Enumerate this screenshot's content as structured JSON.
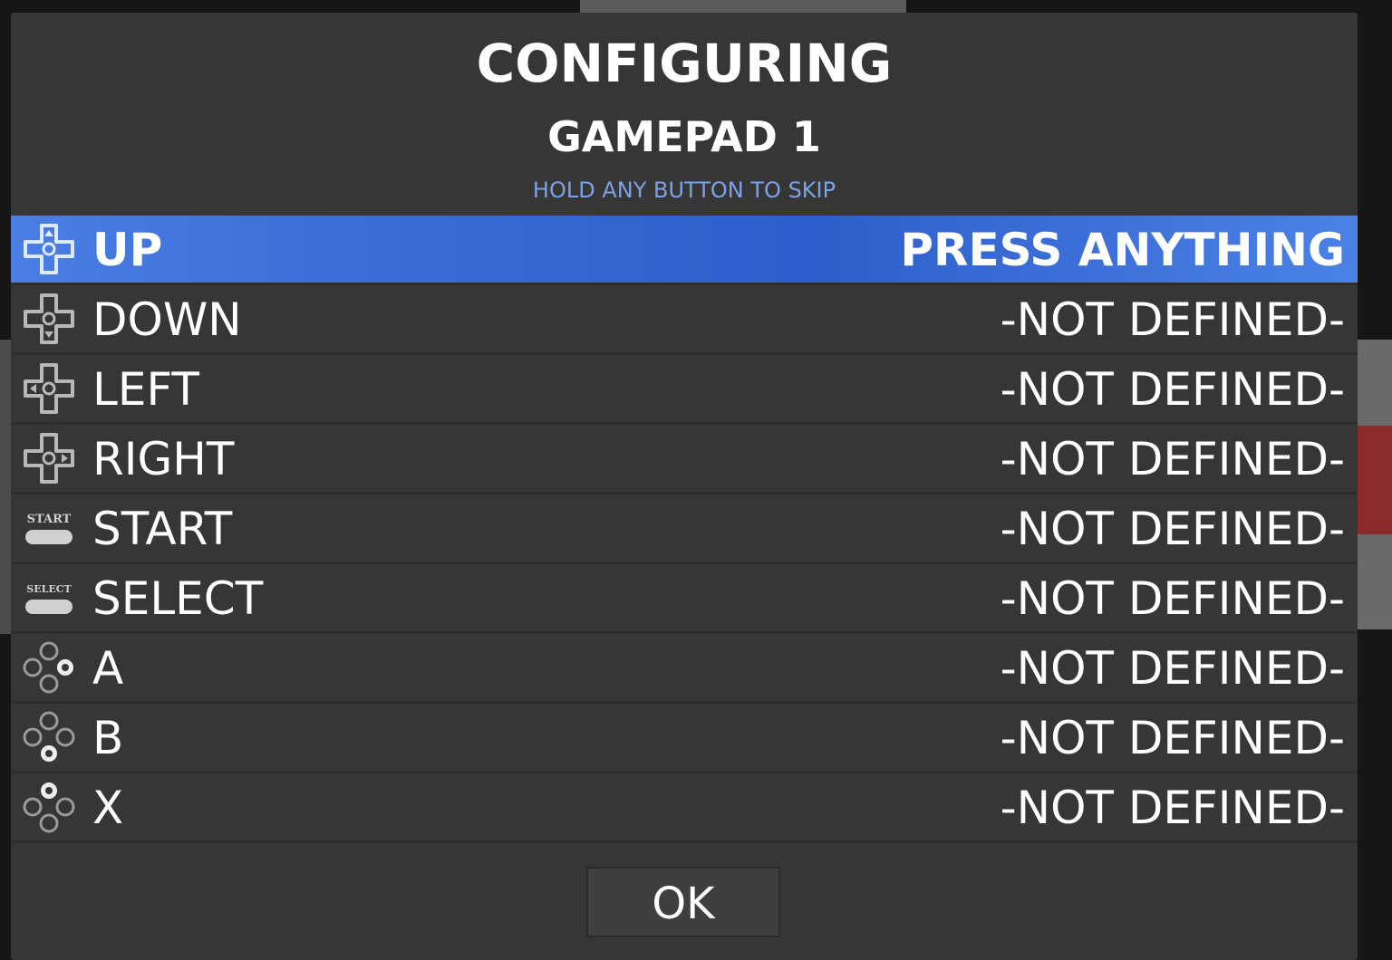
{
  "header": {
    "title": "CONFIGURING",
    "subtitle": "GAMEPAD 1",
    "hint": "HOLD ANY BUTTON TO SKIP"
  },
  "mappings": [
    {
      "label": "UP",
      "value": "PRESS ANYTHING",
      "icon": "dpad-up-icon",
      "selected": true
    },
    {
      "label": "DOWN",
      "value": "-NOT DEFINED-",
      "icon": "dpad-down-icon"
    },
    {
      "label": "LEFT",
      "value": "-NOT DEFINED-",
      "icon": "dpad-left-icon"
    },
    {
      "label": "RIGHT",
      "value": "-NOT DEFINED-",
      "icon": "dpad-right-icon"
    },
    {
      "label": "START",
      "value": "-NOT DEFINED-",
      "icon": "start-button-icon",
      "icon_text": "START"
    },
    {
      "label": "SELECT",
      "value": "-NOT DEFINED-",
      "icon": "select-button-icon",
      "icon_text": "SELECT"
    },
    {
      "label": "A",
      "value": "-NOT DEFINED-",
      "icon": "face-buttons-a-icon"
    },
    {
      "label": "B",
      "value": "-NOT DEFINED-",
      "icon": "face-buttons-b-icon"
    },
    {
      "label": "X",
      "value": "-NOT DEFINED-",
      "icon": "face-buttons-x-icon"
    }
  ],
  "ok_label": "OK",
  "colors": {
    "dialog_bg": "#363636",
    "selected_row": "#3a6ad6",
    "hint_text": "#7ea2e4",
    "text": "#ffffff"
  }
}
